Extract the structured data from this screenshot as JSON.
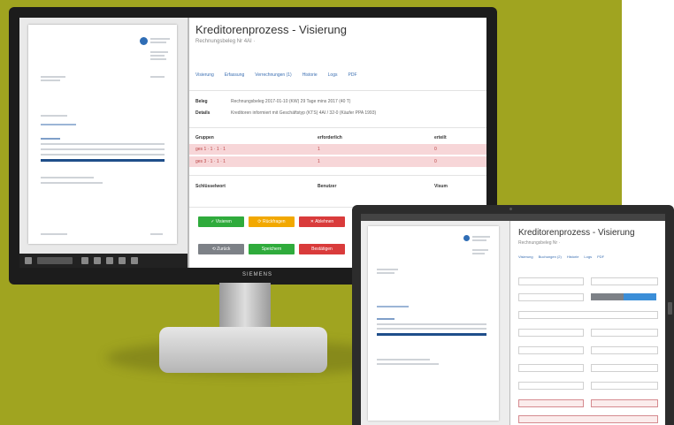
{
  "monitor": {
    "brand": "SIEMENS",
    "app": {
      "title": "Kreditorenprozess - Visierung",
      "subtitle": "Rechnungsbeleg Nr 4AI ·",
      "tabs": [
        "Visierung",
        "Erfassung",
        "Verrechnungen (1)",
        "Historie",
        "Logs",
        "PDF"
      ],
      "info": [
        {
          "key": "Beleg",
          "value": "Rechnungsbeleg 2017-01-10 (KW) 29 Tage mins 2017 (40 T)"
        },
        {
          "key": "Details",
          "value": "Kreditoren informiert mit Geschäftstyp (KTS) 4AI / 32-0 (Käufer PPA 1993)"
        }
      ],
      "table_headers": [
        "Gruppen",
        "erforderlich",
        "erteilt"
      ],
      "table_rows": [
        {
          "group": "ges 1 · 1 · 1 · 1",
          "required": "1",
          "given": "0"
        },
        {
          "group": "ges 3 · 1 · 1 · 1",
          "required": "1",
          "given": "0"
        }
      ],
      "comment_headers": [
        "Schlüsselwort",
        "Benutzer",
        "Visum"
      ],
      "buttons_row1": [
        {
          "label": "✓ Visieren",
          "color": "#2fab3c"
        },
        {
          "label": "⟳ Rückfragen",
          "color": "#f2a800"
        },
        {
          "label": "✕ Ablehnen",
          "color": "#d93b3b"
        }
      ],
      "buttons_row2": [
        {
          "label": "⟲ Zurück",
          "color": "#7d8187"
        },
        {
          "label": "Speichern",
          "color": "#2fab3c"
        },
        {
          "label": "Bestätigen",
          "color": "#d93b3b"
        }
      ]
    }
  },
  "laptop": {
    "app": {
      "title": "Kreditorenprozess - Visierung",
      "subtitle": "Rechnungsbeleg Nr ·",
      "tabs": [
        "Visierung",
        "Buchungen (2)",
        "Historie",
        "Logs",
        "PDF"
      ]
    }
  },
  "colors": {
    "background": "#a0a420",
    "accent": "#3b6fb2",
    "danger_row": "#f7d6d8"
  }
}
